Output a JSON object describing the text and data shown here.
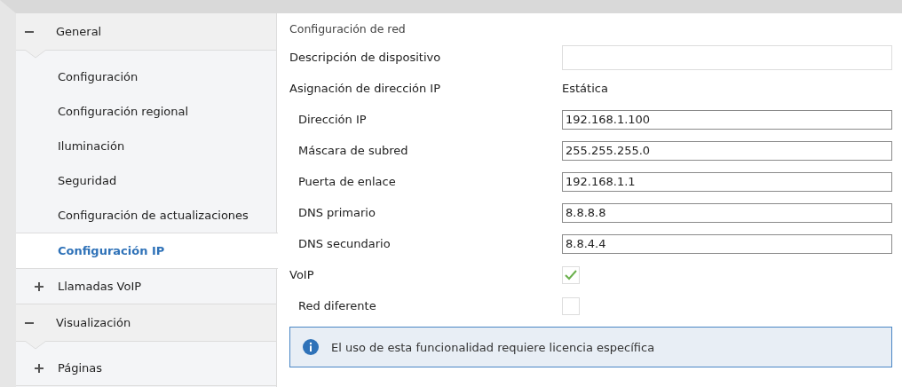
{
  "sidebar": {
    "groups": [
      {
        "label": "General",
        "expanded": true,
        "items": [
          {
            "label": "Configuración",
            "selected": false,
            "expandable": false
          },
          {
            "label": "Configuración regional",
            "selected": false,
            "expandable": false
          },
          {
            "label": "Iluminación",
            "selected": false,
            "expandable": false
          },
          {
            "label": "Seguridad",
            "selected": false,
            "expandable": false
          },
          {
            "label": "Configuración de actualizaciones",
            "selected": false,
            "expandable": false
          },
          {
            "label": "Configuración IP",
            "selected": true,
            "expandable": false
          },
          {
            "label": "Llamadas VoIP",
            "selected": false,
            "expandable": true,
            "expanded": false
          }
        ]
      },
      {
        "label": "Visualización",
        "expanded": true,
        "items": [
          {
            "label": "Páginas",
            "selected": false,
            "expandable": true,
            "expanded": false
          }
        ]
      }
    ]
  },
  "content": {
    "section_title": "Configuración de red",
    "rows": [
      {
        "kind": "input",
        "label": "Descripción de dispositivo",
        "indented": false,
        "value": ""
      },
      {
        "kind": "value",
        "label": "Asignación de dirección IP",
        "indented": false,
        "value": "Estática"
      },
      {
        "kind": "input",
        "label": "Dirección IP",
        "indented": true,
        "value": "192.168.1.100"
      },
      {
        "kind": "input",
        "label": "Máscara de subred",
        "indented": true,
        "value": "255.255.255.0"
      },
      {
        "kind": "input",
        "label": "Puerta de enlace",
        "indented": true,
        "value": "192.168.1.1"
      },
      {
        "kind": "input",
        "label": "DNS primario",
        "indented": true,
        "value": "8.8.8.8"
      },
      {
        "kind": "input",
        "label": "DNS secundario",
        "indented": true,
        "value": "8.8.4.4"
      },
      {
        "kind": "checkbox",
        "label": "VoIP",
        "indented": false,
        "checked": true
      },
      {
        "kind": "checkbox",
        "label": "Red diferente",
        "indented": true,
        "checked": false
      }
    ],
    "info": "El uso de esta funcionalidad requiere licencia específica"
  }
}
